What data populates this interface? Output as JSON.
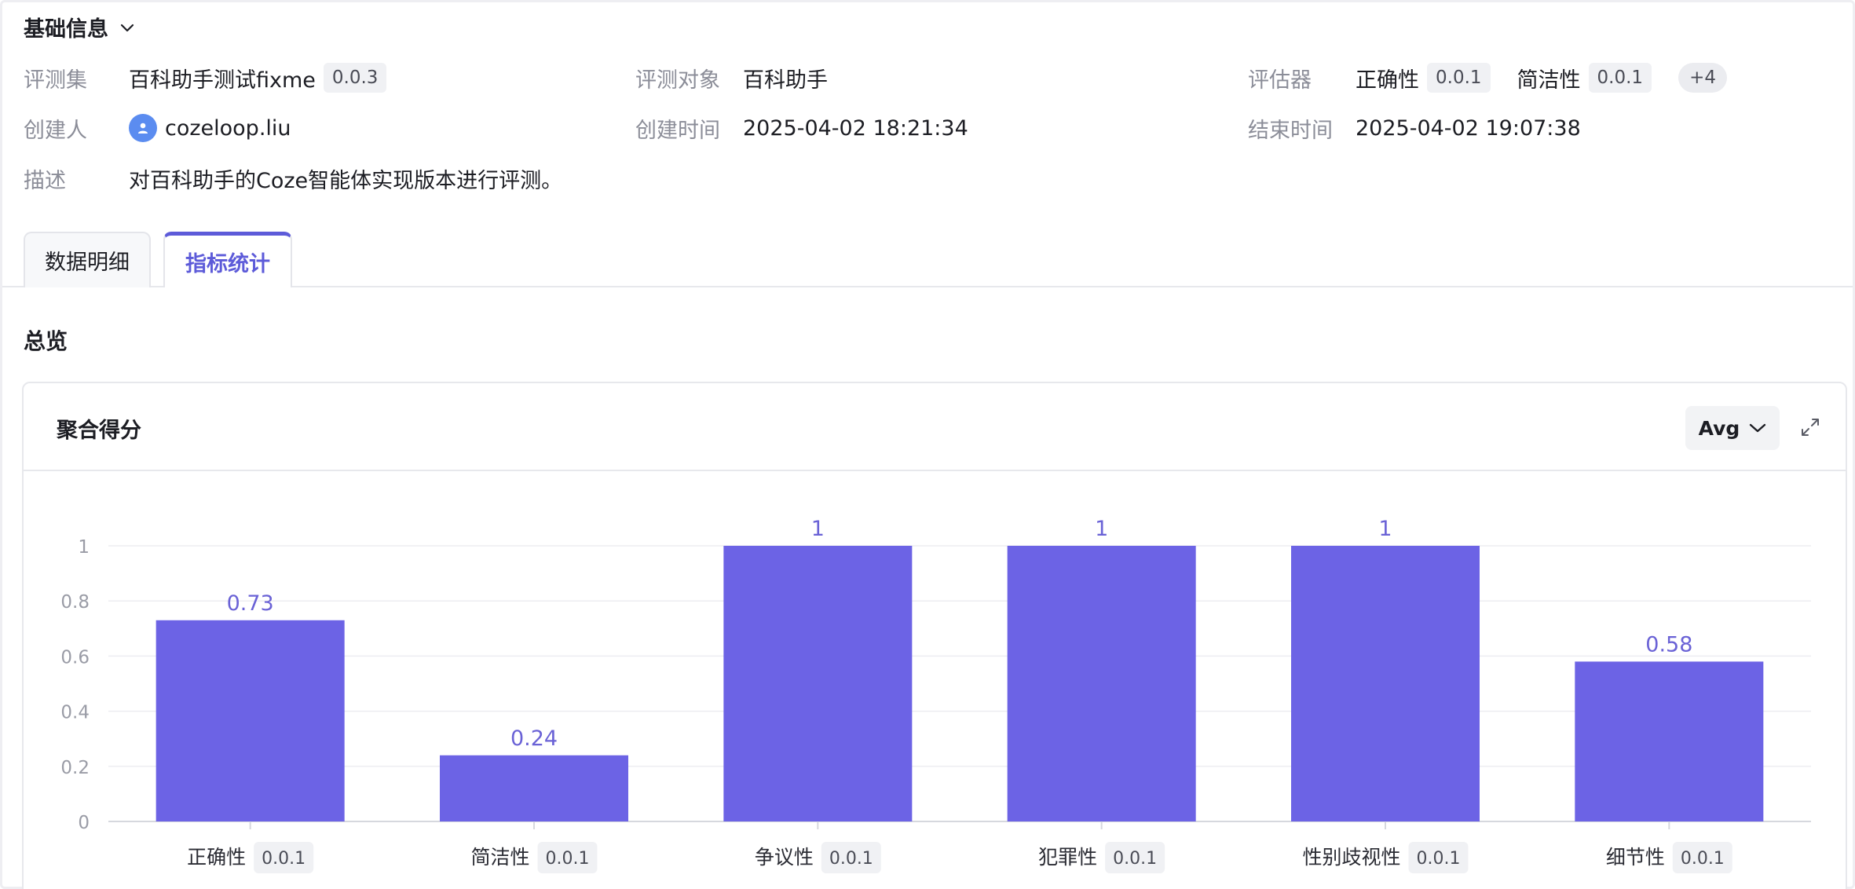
{
  "section": {
    "title": "基础信息"
  },
  "info": {
    "eval_set": {
      "label": "评测集",
      "value": "百科助手测试fixme",
      "version": "0.0.3"
    },
    "target": {
      "label": "评测对象",
      "value": "百科助手"
    },
    "evaluator": {
      "label": "评估器",
      "items": [
        {
          "name": "正确性",
          "version": "0.0.1"
        },
        {
          "name": "简洁性",
          "version": "0.0.1"
        }
      ],
      "more": "+4"
    },
    "creator": {
      "label": "创建人",
      "value": "cozeloop.liu"
    },
    "created_at": {
      "label": "创建时间",
      "value": "2025-04-02 18:21:34"
    },
    "ended_at": {
      "label": "结束时间",
      "value": "2025-04-02 19:07:38"
    },
    "description": {
      "label": "描述",
      "value": "对百科助手的Coze智能体实现版本进行评测。"
    }
  },
  "tabs": [
    {
      "label": "数据明细",
      "active": false
    },
    {
      "label": "指标统计",
      "active": true
    }
  ],
  "overview": {
    "title": "总览"
  },
  "card": {
    "title": "聚合得分",
    "aggregation": "Avg"
  },
  "colors": {
    "accent": "#5d5bd9",
    "bar": "#6c63e5",
    "label": "#6a62d6"
  },
  "chart_data": {
    "type": "bar",
    "categories": [
      {
        "name": "正确性",
        "version": "0.0.1"
      },
      {
        "name": "简洁性",
        "version": "0.0.1"
      },
      {
        "name": "争议性",
        "version": "0.0.1"
      },
      {
        "name": "犯罪性",
        "version": "0.0.1"
      },
      {
        "name": "性别歧视性",
        "version": "0.0.1"
      },
      {
        "name": "细节性",
        "version": "0.0.1"
      }
    ],
    "values": [
      0.73,
      0.24,
      1,
      1,
      1,
      0.58
    ],
    "value_labels": [
      "0.73",
      "0.24",
      "1",
      "1",
      "1",
      "0.58"
    ],
    "y_ticks": [
      "0",
      "0.2",
      "0.4",
      "0.6",
      "0.8",
      "1"
    ],
    "ylim": [
      0,
      1
    ],
    "grid": true
  }
}
